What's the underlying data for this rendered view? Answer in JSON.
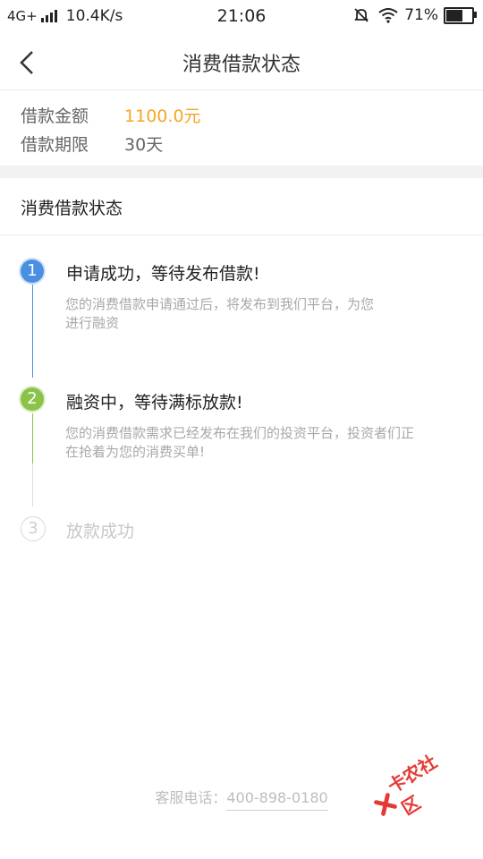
{
  "status_bar": {
    "network": "4G+",
    "speed": "10.4K/s",
    "time": "21:06",
    "battery": "71%",
    "battery_level": 0.71
  },
  "nav": {
    "title": "消费借款状态"
  },
  "info": {
    "amount_label": "借款金额",
    "amount_value": "1100.0元",
    "term_label": "借款期限",
    "term_value": "30天"
  },
  "section": {
    "title": "消费借款状态"
  },
  "steps": [
    {
      "number": "1",
      "title": "申请成功，等待发布借款!",
      "desc_line1": "您的消费借款申请通过后，将发布到我们平台，为您",
      "desc_line2": "进行融资",
      "color": "#4a90e2"
    },
    {
      "number": "2",
      "title": "融资中，等待满标放款!",
      "desc_line1": "您的消费借款需求已经发布在我们的投资平台，投资者们正",
      "desc_line2": "在抢着为您的消费买单!",
      "color": "#8bc34a"
    },
    {
      "number": "3",
      "title": "放款成功",
      "color": "#d0d0d0"
    }
  ],
  "footer": {
    "label": "客服电话：",
    "phone": "400-898-0180"
  },
  "watermark": {
    "text": "卡农社区"
  },
  "colors": {
    "accent_amount": "#f5a623",
    "step1": "#4a90e2",
    "step2": "#8bc34a",
    "step3": "#d0d0d0"
  }
}
